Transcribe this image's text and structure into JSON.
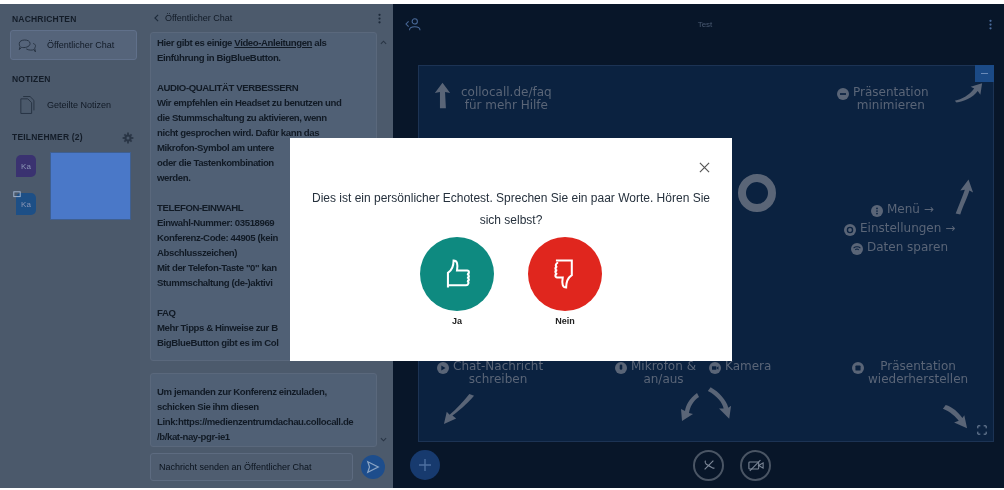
{
  "sidebar": {
    "sections": [
      {
        "title": "NACHRICHTEN",
        "items": [
          {
            "label": "Öffentlicher Chat",
            "kind": "chat",
            "selected": true
          }
        ]
      },
      {
        "title": "NOTIZEN",
        "items": [
          {
            "label": "Geteilte Notizen",
            "kind": "notes",
            "selected": false
          }
        ]
      }
    ],
    "participants": {
      "title": "TEILNEHMER (2)",
      "users": [
        {
          "initials": "Ka",
          "color": "#3a3270",
          "presenter": false
        },
        {
          "initials": "Ka",
          "color": "#1d4f86",
          "presenter": true
        }
      ]
    }
  },
  "chat": {
    "title": "Öffentlicher Chat",
    "messages": [
      {
        "blocks": [
          {
            "lines": [
              {
                "text": "Hier gibt es einige ",
                "link": "Video-Anleitungen",
                "after": " als"
              },
              {
                "text": "Einführung in BigBlueButton."
              }
            ]
          },
          {
            "heading": "AUDIO-QUALITÄT VERBESSERN",
            "lines": [
              {
                "text": "Wir empfehlen ein Headset zu benutzen und"
              },
              {
                "text": "die Stummschaltung zu aktivieren, wenn"
              },
              {
                "text": "nicht gesprochen wird. Dafür kann das"
              },
              {
                "text": "Mikrofon-Symbol am untere"
              },
              {
                "text": "oder die Tastenkombination"
              },
              {
                "text": "werden."
              }
            ]
          },
          {
            "heading": "TELEFON-EINWAHL",
            "lines": [
              {
                "text": "Einwahl-Nummer: 03518969"
              },
              {
                "text": "Konferenz-Code: 44905 (kein"
              },
              {
                "text": "Abschlusszeichen)"
              },
              {
                "text": "Mit der Telefon-Taste \"0\" kan"
              },
              {
                "text": "Stummschaltung (de-)aktivi"
              }
            ]
          },
          {
            "heading": "FAQ",
            "lines": [
              {
                "text": "Mehr Tipps & Hinweise zur B"
              },
              {
                "text": "BigBlueButton gibt es im Col"
              }
            ]
          }
        ]
      },
      {
        "blocks": [
          {
            "lines": [
              {
                "text": "Um jemanden zur Konferenz einzuladen,"
              },
              {
                "text": "schicken Sie ihm diesen"
              },
              {
                "text": "Link:https://medienzentrumdachau.collocall.de"
              },
              {
                "text": "/b/kat-nay-pgr-ie1"
              }
            ]
          }
        ]
      }
    ],
    "input": {
      "placeholder": "Nachricht senden an Öffentlicher Chat"
    }
  },
  "presentation": {
    "title": "Test",
    "hints": [
      {
        "kind": "help",
        "lines": [
          "collocall.de/faq",
          "für mehr Hilfe"
        ]
      },
      {
        "kind": "minimize",
        "lines": [
          "Präsentation",
          "minimieren"
        ]
      },
      {
        "kind": "menu",
        "lines": [
          "Menü →"
        ]
      },
      {
        "kind": "settings",
        "lines": [
          "Einstellungen →"
        ]
      },
      {
        "kind": "data",
        "lines": [
          "Daten sparen"
        ]
      },
      {
        "kind": "chat",
        "lines": [
          "Chat-Nachricht",
          "schreiben"
        ]
      },
      {
        "kind": "mic",
        "lines": [
          "Mikrofon &",
          "an/aus"
        ]
      },
      {
        "kind": "camera",
        "lines": [
          "Kamera"
        ]
      },
      {
        "kind": "restore",
        "lines": [
          "Präsentation",
          "wiederherstellen"
        ]
      }
    ]
  },
  "dialog": {
    "text": "Dies ist ein persönlicher Echotest. Sprechen Sie ein paar Worte. Hören Sie sich selbst?",
    "buttons": [
      {
        "label": "Ja",
        "kind": "yes"
      },
      {
        "label": "Nein",
        "kind": "no"
      }
    ]
  }
}
